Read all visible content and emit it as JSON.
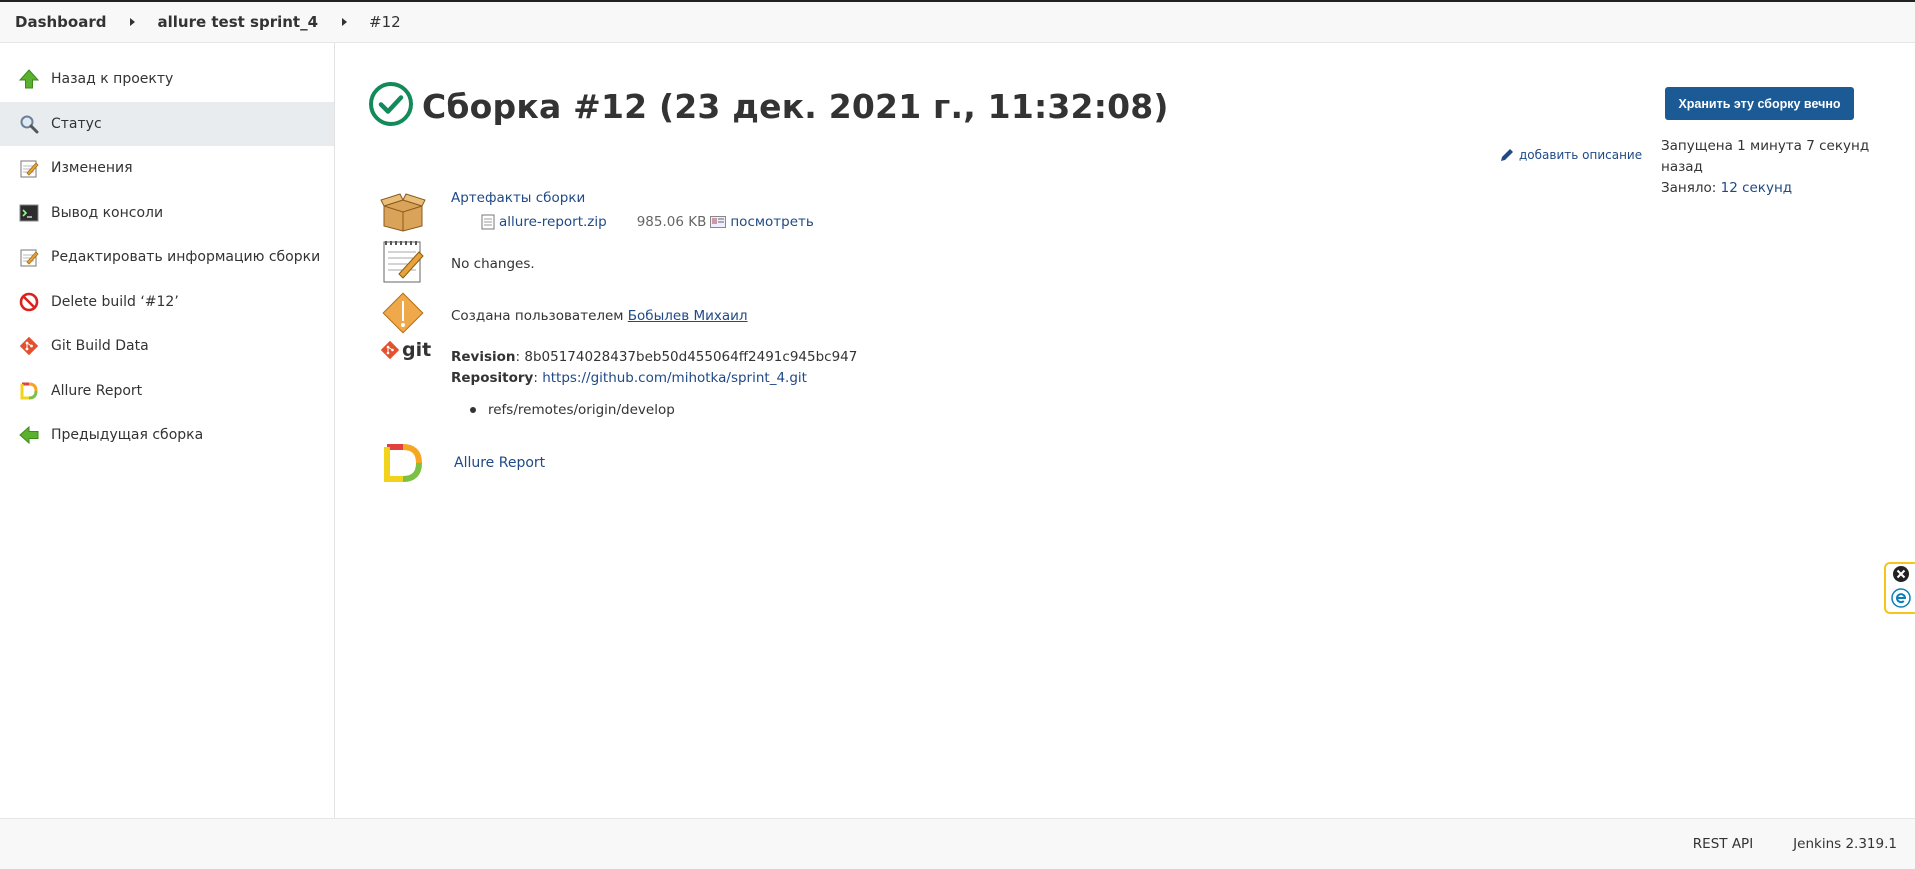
{
  "breadcrumb": {
    "items": [
      "Dashboard",
      "allure test sprint_4",
      "#12"
    ]
  },
  "sidebar": {
    "items": [
      {
        "label": "Назад к проекту",
        "icon": "arrow-up-icon"
      },
      {
        "label": "Статус",
        "icon": "search-icon"
      },
      {
        "label": "Изменения",
        "icon": "notepad-icon"
      },
      {
        "label": "Вывод консоли",
        "icon": "terminal-icon"
      },
      {
        "label": "Редактировать информацию сборки",
        "icon": "notepad-icon"
      },
      {
        "label": "Delete build ‘#12’",
        "icon": "no-entry-icon"
      },
      {
        "label": "Git Build Data",
        "icon": "git-icon"
      },
      {
        "label": "Allure Report",
        "icon": "allure-icon"
      },
      {
        "label": "Предыдущая сборка",
        "icon": "arrow-left-icon"
      }
    ]
  },
  "build": {
    "title": "Сборка #12 (23 дек. 2021 г., 11:32:08)",
    "status": "success",
    "keep_button": "Хранить эту сборку вечно",
    "add_description": "добавить описание",
    "started_label": "Запущена 1 минута 7 секунд назад",
    "took_prefix": "Заняло: ",
    "took_value": "12 секунд"
  },
  "artifacts": {
    "title": "Артефакты сборки",
    "file_name": "allure-report.zip",
    "file_size": "985.06 KB",
    "view_label": "посмотреть"
  },
  "changes": {
    "text": "No changes."
  },
  "cause": {
    "prefix": "Создана пользователем ",
    "user": "Бобылев Михаил"
  },
  "git": {
    "revision_label": "Revision",
    "revision_value": ": 8b05174028437beb50d455064ff2491c945bc947",
    "repository_label": "Repository",
    "repository_sep": ": ",
    "repository_url": "https://github.com/mihotka/sprint_4.git",
    "branch": "refs/remotes/origin/develop",
    "logo_text": "git"
  },
  "allure": {
    "label": "Allure Report"
  },
  "footer": {
    "rest_api": "REST API",
    "version": "Jenkins 2.319.1"
  },
  "colors": {
    "accent": "#1c5a96",
    "link": "#204a87",
    "success": "#138a5a"
  }
}
